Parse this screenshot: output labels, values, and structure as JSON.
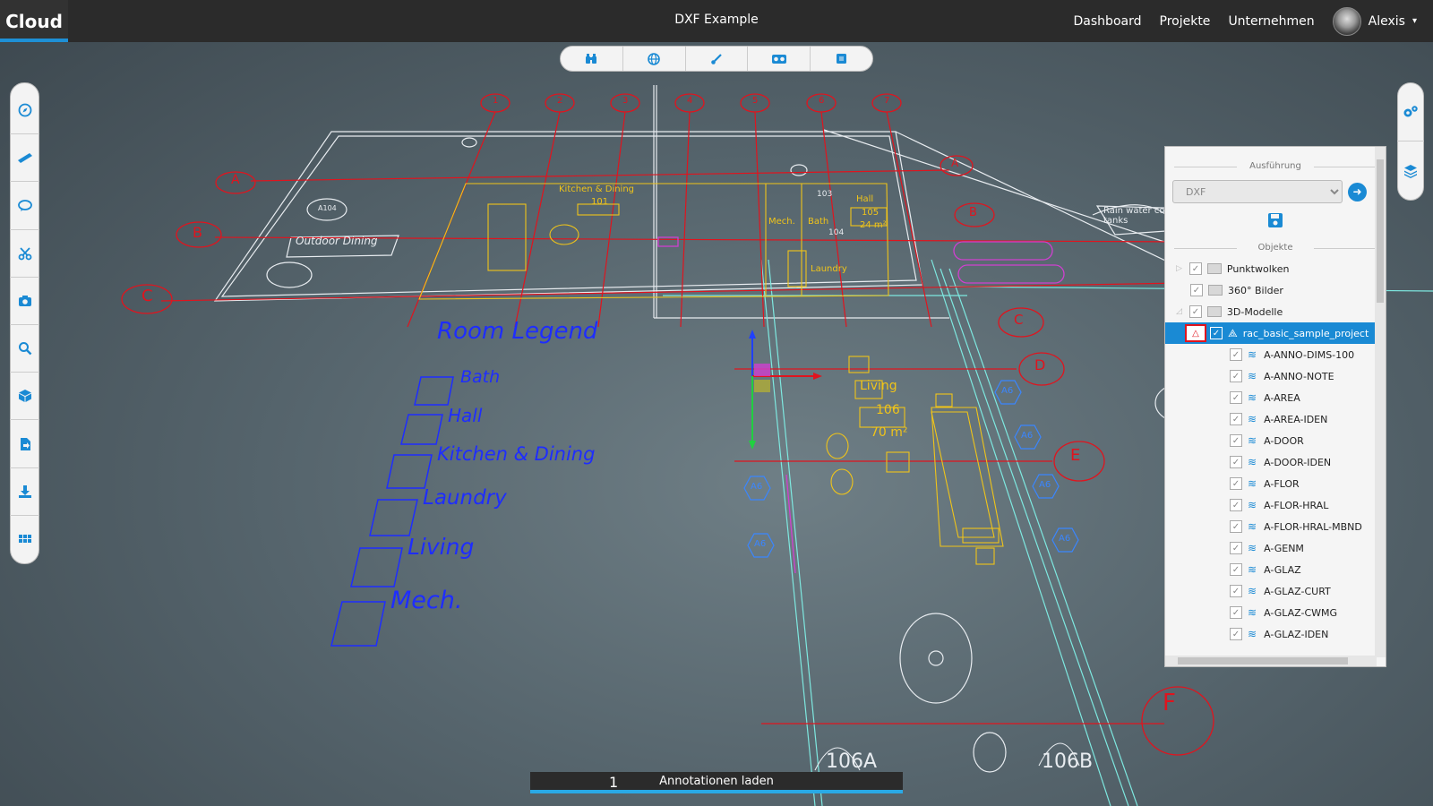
{
  "app": {
    "brand": "Cloud",
    "document_title": "DXF Example"
  },
  "nav": {
    "items": [
      "Dashboard",
      "Projekte",
      "Unternehmen"
    ],
    "user_name": "Alexis"
  },
  "top_toolbar": {
    "icons": [
      "binoculars-icon",
      "globe-icon",
      "brush-icon",
      "vr-glasses-icon",
      "cube-icon"
    ]
  },
  "left_toolbar": {
    "icons": [
      "compass-icon",
      "ruler-icon",
      "comment-icon",
      "scissors-icon",
      "camera-icon",
      "search-icon",
      "box-icon",
      "file-import-icon",
      "download-icon",
      "grid-icon"
    ]
  },
  "right_toolbar": {
    "icons": [
      "settings-icon",
      "layers-icon"
    ]
  },
  "panel": {
    "execution_title": "Ausführung",
    "format_select": "DXF",
    "objects_title": "Objekte",
    "groups": [
      "Punktwolken",
      "360° Bilder",
      "3D-Modelle"
    ],
    "selected_model": "rac_basic_sample_project",
    "layers": [
      "A-ANNO-DIMS-100",
      "A-ANNO-NOTE",
      "A-AREA",
      "A-AREA-IDEN",
      "A-DOOR",
      "A-DOOR-IDEN",
      "A-FLOR",
      "A-FLOR-HRAL",
      "A-FLOR-HRAL-MBND",
      "A-GENM",
      "A-GLAZ",
      "A-GLAZ-CURT",
      "A-GLAZ-CWMG",
      "A-GLAZ-IDEN"
    ]
  },
  "scene": {
    "legend_title": "Room Legend",
    "legend_items": [
      "Bath",
      "Hall",
      "Kitchen & Dining",
      "Laundry",
      "Living",
      "Mech."
    ],
    "plan_labels": {
      "kitchen": "Kitchen & Dining",
      "hall": "Hall",
      "mech": "Mech.",
      "bath": "Bath",
      "laundry": "Laundry",
      "living": "Living",
      "outdoor": "Outdoor Dining",
      "rainwater": "Rain water collection tanks",
      "room_106": "106",
      "area_70": "70 m²",
      "room_101": "101",
      "room_103": "103",
      "room_105": "105",
      "room_104": "104",
      "area_24": "24 m²",
      "a104": "A104",
      "tag_106a": "106A",
      "tag_106b": "106B"
    },
    "grid_bubbles_top": [
      "1",
      "2",
      "3",
      "4",
      "5",
      "6",
      "7"
    ],
    "grid_bubbles_side": [
      "A",
      "B",
      "C",
      "A",
      "B",
      "C",
      "D",
      "E",
      "F"
    ],
    "section_tags": [
      "A6",
      "A6",
      "A6",
      "A6",
      "A6",
      "A6"
    ],
    "colors": {
      "legend": "#1e2dff",
      "plan_white": "#e8ecf0",
      "plan_yellow": "#f0c419",
      "grid_red": "#e0141e",
      "cyan": "#7ee8e0",
      "accent": "#1a8ad4"
    }
  },
  "loader": {
    "label": "Annotationen laden",
    "count": "1"
  }
}
